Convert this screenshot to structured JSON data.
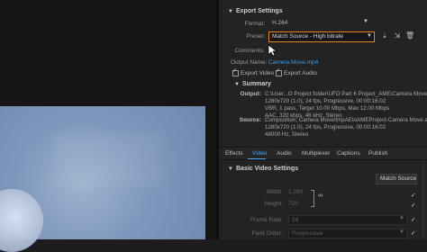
{
  "export_settings": {
    "header": "Export Settings",
    "format_label": "Format:",
    "format_value": "H.264",
    "preset_label": "Preset:",
    "preset_value": "Match Source - High bitrate",
    "comments_label": "Comments:",
    "output_name_label": "Output Name:",
    "output_name_value": "Camera Move.mp4",
    "export_video_label": "Export Video",
    "export_audio_label": "Export Audio"
  },
  "summary": {
    "header": "Summary",
    "output_label": "Output:",
    "output_lines": [
      "C:\\User...O Project folder\\UFO Part 6 Project_AME\\Camera Move.mp4",
      "1280x720 (1.0), 24 fps, Progressive, 00:00:16:02",
      "VBR, 1 pass, Target 10.00 Mbps, Max 12.00 Mbps",
      "AAC, 320 kbps, 48 kHz, Stereo"
    ],
    "source_label": "Source:",
    "source_lines": [
      "Composition, Camera Move/tmpAEtoAMEProject-Camera Move.aep",
      "1280x720 (1.0), 24 fps, Progressive, 00:00:16:02",
      "48000 Hz, Stereo"
    ]
  },
  "tabs": [
    {
      "label": "Effects",
      "active": false
    },
    {
      "label": "Video",
      "active": true
    },
    {
      "label": "Audio",
      "active": false
    },
    {
      "label": "Multiplexer",
      "active": false
    },
    {
      "label": "Captions",
      "active": false
    },
    {
      "label": "Publish",
      "active": false
    }
  ],
  "video_settings": {
    "header": "Basic Video Settings",
    "match_source_button": "Match Source",
    "width_label": "Width:",
    "width_value": "1,280",
    "height_label": "Height:",
    "height_value": "720",
    "frame_rate_label": "Frame Rate:",
    "frame_rate_value": "24",
    "field_order_label": "Field Order:",
    "field_order_value": "Progressive"
  },
  "colors": {
    "accent": "#e08a1e",
    "link": "#3aa0e6",
    "active_tab": "#4aa8ff"
  }
}
